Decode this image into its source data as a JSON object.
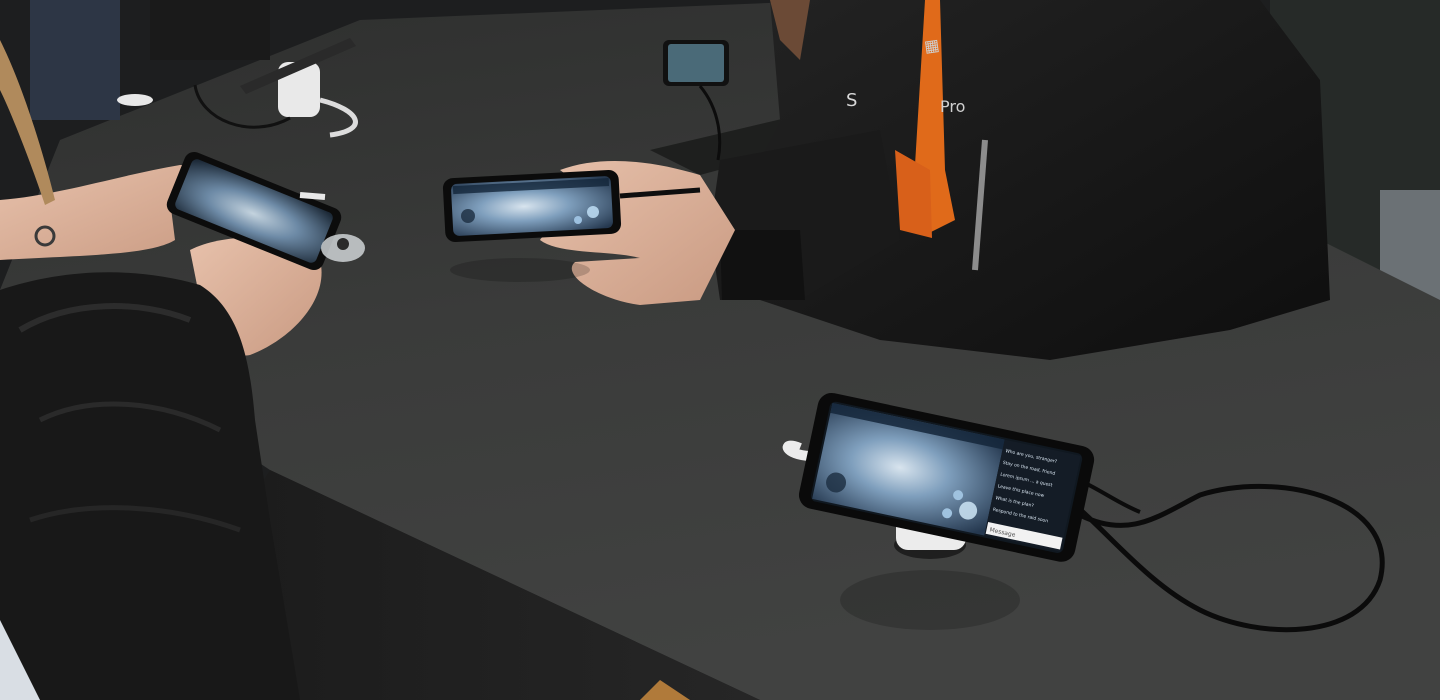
{
  "scene": {
    "description_visible_text": {
      "jacket_text_top": "S",
      "jacket_text_mid": "Pro",
      "lanyard_text": "",
      "chat_lines": [
        "Who are you, stranger?",
        "Stay on the road, friend",
        "Lorem ipsum ... a quest",
        "Leave this place now",
        "What is the plan?",
        "Respond to the raid soon"
      ],
      "message_label": "Message"
    },
    "colors": {
      "table_top": "#363736",
      "table_side": "#232423",
      "floor": "#1b1c1d",
      "jacket": "#161616",
      "lanyard_orange": "#e06a1a",
      "stand_white": "#e9e9e9",
      "game_blue": "#3c6a9a"
    }
  }
}
